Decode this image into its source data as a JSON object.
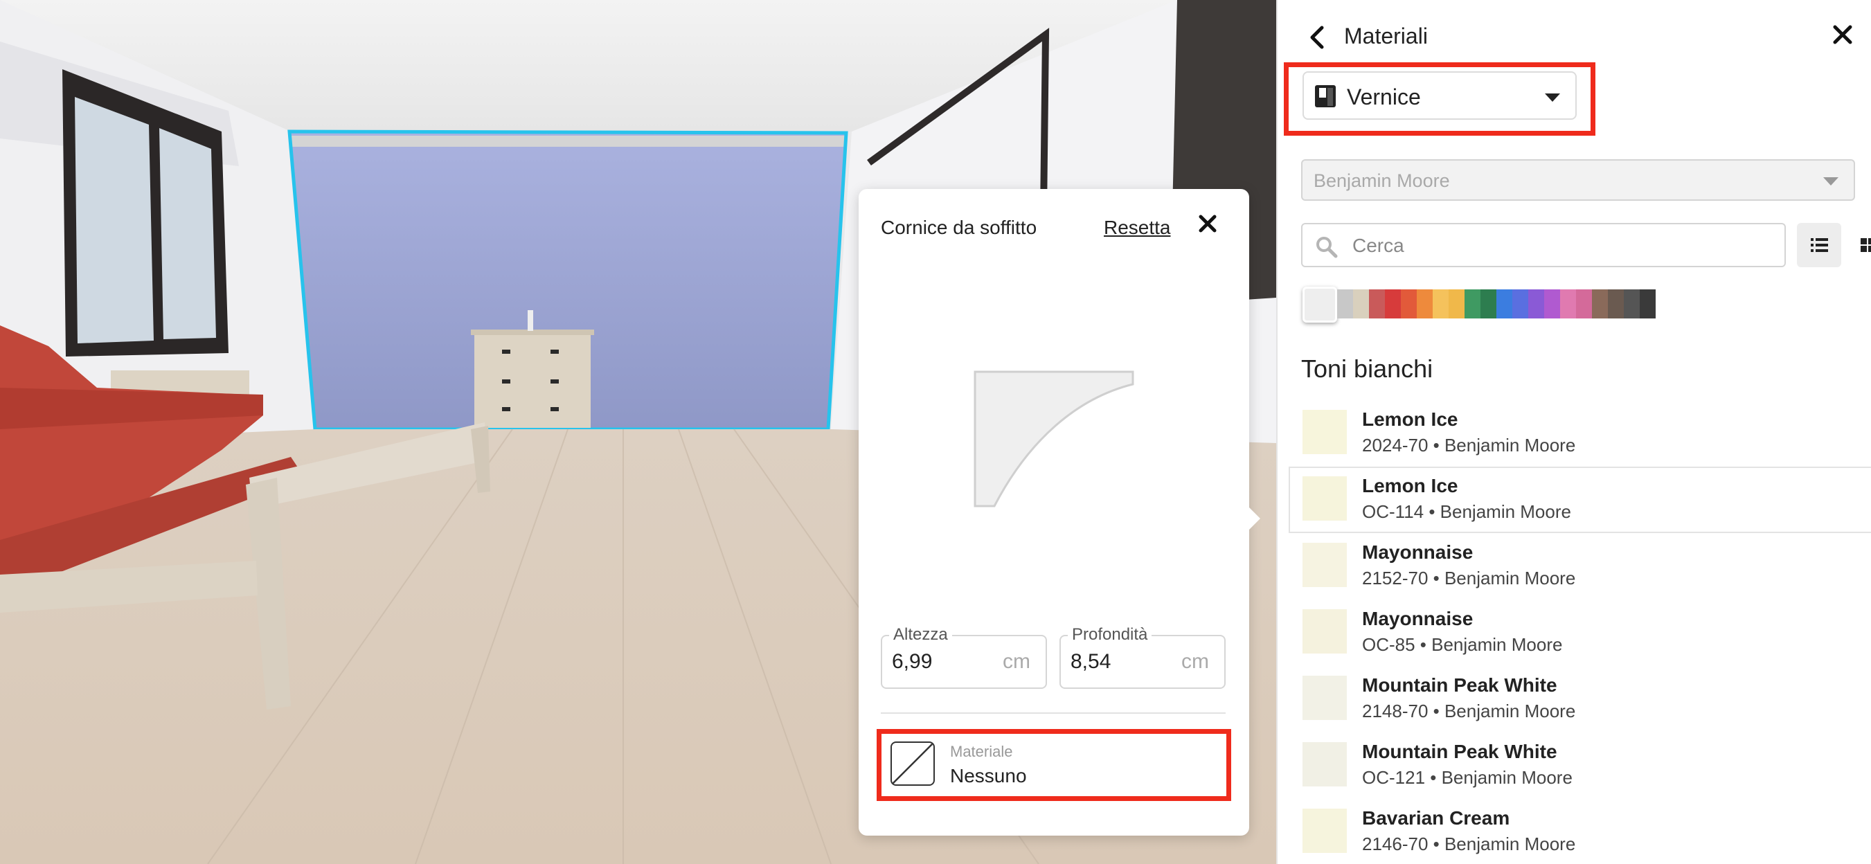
{
  "cornice_panel": {
    "title": "Cornice da soffitto",
    "reset_label": "Resetta",
    "altezza": {
      "label": "Altezza",
      "value": "6,99",
      "unit": "cm"
    },
    "profondita": {
      "label": "Profondità",
      "value": "8,54",
      "unit": "cm"
    },
    "material": {
      "label": "Materiale",
      "value": "Nessuno"
    }
  },
  "materials_panel": {
    "title": "Materiali",
    "type_select": {
      "value": "Vernice"
    },
    "brand_select": {
      "value": "Benjamin Moore"
    },
    "search": {
      "placeholder": "Cerca",
      "value": ""
    },
    "palette": [
      "#eeeeee",
      "#c8c8c8",
      "#d9d0bd",
      "#c95a5a",
      "#d73b3b",
      "#e25a3a",
      "#ee8a3c",
      "#f5c25c",
      "#f0b84a",
      "#3f9a62",
      "#2d7d4f",
      "#3b7de0",
      "#5a6fe0",
      "#8a5ad6",
      "#b05ad0",
      "#e07ab0",
      "#d46a9a",
      "#8a6a5a",
      "#6a5a50",
      "#555555",
      "#3a3a3a"
    ],
    "section_title": "Toni bianchi",
    "colors": [
      {
        "name": "Lemon Ice",
        "code": "2024-70 • Benjamin Moore",
        "hex": "#f7f5dc"
      },
      {
        "name": "Lemon Ice",
        "code": "OC-114 • Benjamin Moore",
        "hex": "#f6f4dc"
      },
      {
        "name": "Mayonnaise",
        "code": "2152-70 • Benjamin Moore",
        "hex": "#f6f3e1"
      },
      {
        "name": "Mayonnaise",
        "code": "OC-85 • Benjamin Moore",
        "hex": "#f5f2de"
      },
      {
        "name": "Mountain Peak White",
        "code": "2148-70 • Benjamin Moore",
        "hex": "#f2f1e6"
      },
      {
        "name": "Mountain Peak White",
        "code": "OC-121 • Benjamin Moore",
        "hex": "#f1f0e5"
      },
      {
        "name": "Bavarian Cream",
        "code": "2146-70 • Benjamin Moore",
        "hex": "#f6f4dd"
      }
    ]
  },
  "colors": {
    "highlight": "#ef2b1c",
    "selection": "#27c3ec",
    "accent": "#222222"
  }
}
